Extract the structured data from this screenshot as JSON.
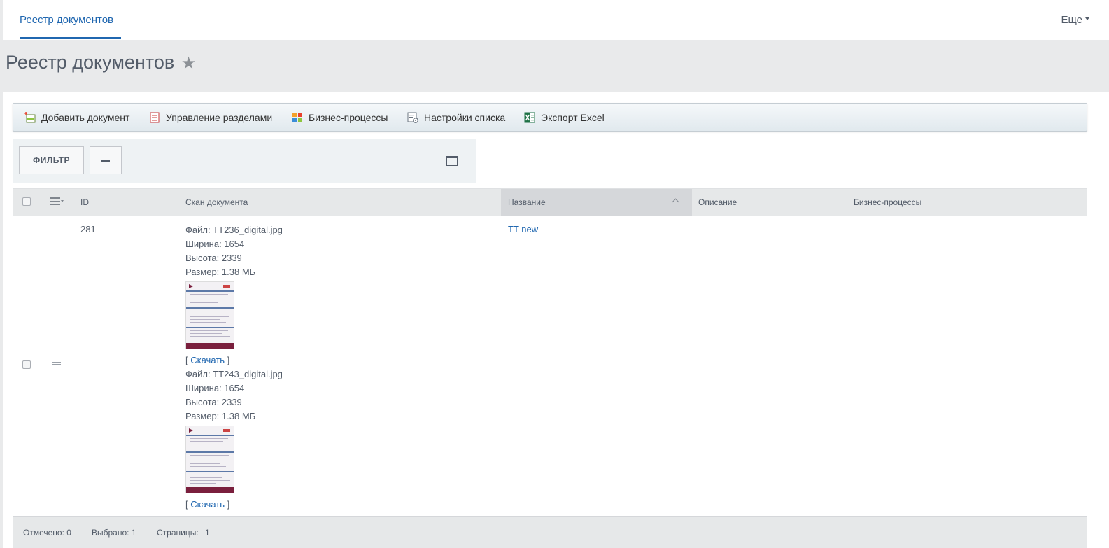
{
  "topnav": {
    "tab_label": "Реестр документов",
    "more_label": "Еще"
  },
  "page": {
    "title": "Реестр документов",
    "star": "★"
  },
  "toolbar": {
    "add_document": "Добавить документ",
    "manage_sections": "Управление разделами",
    "business_processes": "Бизнес-процессы",
    "list_settings": "Настройки списка",
    "export_excel": "Экспорт Excel"
  },
  "filter": {
    "button_label": "ФИЛЬТР"
  },
  "columns": {
    "id": "ID",
    "scan": "Скан документа",
    "name": "Название",
    "description": "Описание",
    "business_processes": "Бизнес-процессы"
  },
  "rows": [
    {
      "id": "281",
      "name": "TT new",
      "files": [
        {
          "file": "Файл: TT236_digital.jpg",
          "width": "Ширина: 1654",
          "height": "Высота: 2339",
          "size": "Размер: 1.38 МБ",
          "download": "Скачать"
        },
        {
          "file": "Файл: TT243_digital.jpg",
          "width": "Ширина: 1654",
          "height": "Высота: 2339",
          "size": "Размер: 1.38 МБ",
          "download": "Скачать"
        }
      ]
    }
  ],
  "footer": {
    "marked": "Отмечено: 0",
    "selected": "Выбрано: 1",
    "pages_label": "Страницы:",
    "pages_value": "1"
  },
  "icons": {
    "add_document": "add-document-icon",
    "manage_sections": "sections-icon",
    "business_processes": "workflow-icon",
    "list_settings": "settings-list-icon",
    "export_excel": "excel-icon"
  },
  "colors": {
    "accent": "#2067b0",
    "title": "#535c69",
    "background": "#e9eaeb"
  }
}
